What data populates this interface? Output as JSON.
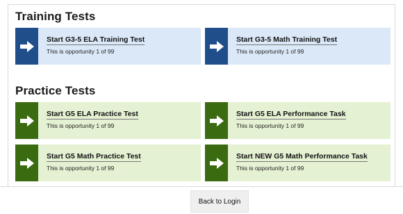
{
  "training": {
    "title": "Training Tests",
    "tiles": [
      {
        "label": "Start G3-5 ELA Training Test",
        "sub": "This is opportunity 1 of 99"
      },
      {
        "label": "Start G3-5 Math Training Test",
        "sub": "This is opportunity 1 of 99"
      }
    ]
  },
  "practice": {
    "title": "Practice Tests",
    "tiles": [
      {
        "label": "Start G5 ELA Practice Test",
        "sub": "This is opportunity 1 of 99"
      },
      {
        "label": "Start G5 ELA Performance Task",
        "sub": "This is opportunity 1 of 99"
      },
      {
        "label": "Start G5 Math Practice Test",
        "sub": "This is opportunity 1 of 99"
      },
      {
        "label": "Start NEW G5 Math Performance Task",
        "sub": "This is opportunity 1 of 99"
      }
    ]
  },
  "footer": {
    "back_label": "Back to Login"
  },
  "colors": {
    "training_arrow": "#1f4e8a",
    "training_bg": "#dbe8f8",
    "practice_arrow": "#3b6b11",
    "practice_bg": "#e4f1d2"
  },
  "icons": {
    "tile_arrow": "arrow-right-icon"
  }
}
